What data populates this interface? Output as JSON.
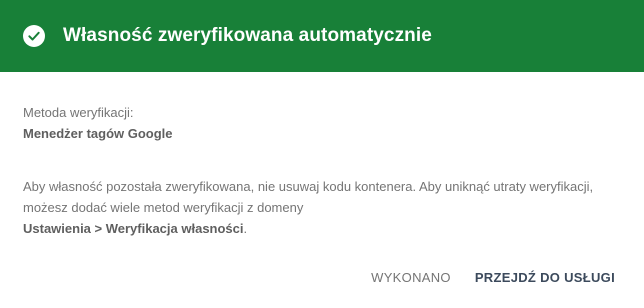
{
  "dialog": {
    "title": "Własność zweryfikowana automatycznie",
    "header_color": "#188038",
    "header_icon": "check-circle-icon"
  },
  "verification": {
    "method_label": "Metoda weryfikacji:",
    "method_value": "Menedżer tagów Google"
  },
  "info": {
    "text": "Aby własność pozostała zweryfikowana, nie usuwaj kodu kontenera. Aby uniknąć utraty weryfikacji, możesz dodać wiele metod weryfikacji z domeny",
    "path": "Ustawienia > Weryfikacja własności",
    "end": "."
  },
  "actions": {
    "done_label": "WYKONANO",
    "go_label": "PRZEJDŹ DO USŁUGI"
  }
}
